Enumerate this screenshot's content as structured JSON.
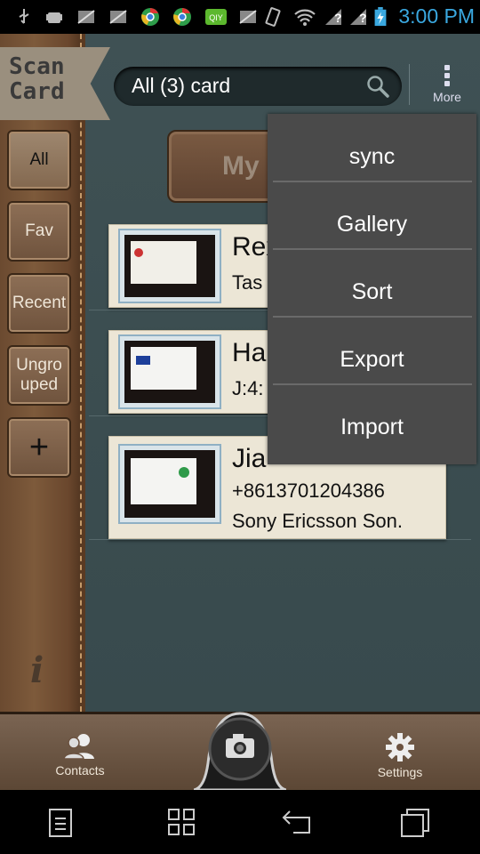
{
  "status_bar": {
    "time": "3:00 PM",
    "icons": [
      "usb-icon",
      "android-icon",
      "muted-notification-icon",
      "muted-notification-icon",
      "chrome-icon",
      "chrome-icon",
      "iqiyi-icon",
      "muted-notification-icon",
      "muted-notification-icon",
      "vibrate-icon",
      "wifi-icon",
      "signal-unknown-icon",
      "signal-unknown-icon",
      "battery-charging-icon"
    ]
  },
  "logo": {
    "line1": "Scan",
    "line2": "Card"
  },
  "search": {
    "text": "All (3) card"
  },
  "more": {
    "label": "More"
  },
  "tabs": [
    {
      "label": "All"
    },
    {
      "label": "Fav"
    },
    {
      "label": "Recent"
    },
    {
      "label": "Ungro\nuped"
    },
    {
      "label": "+"
    }
  ],
  "mycard": {
    "label": "My"
  },
  "cards": [
    {
      "name": "Rex",
      "line2": "Tas",
      "line3": ""
    },
    {
      "name": "Ha",
      "line2": "J:4:",
      "line3": ""
    },
    {
      "name": "Jia",
      "line2": "+8613701204386",
      "line3": "Sony Ericsson Son."
    }
  ],
  "menu": {
    "items": [
      {
        "label": "sync"
      },
      {
        "label": "Gallery"
      },
      {
        "label": "Sort"
      },
      {
        "label": "Export"
      },
      {
        "label": "Import"
      }
    ]
  },
  "bottom_bar": {
    "contacts_label": "Contacts",
    "settings_label": "Settings"
  },
  "colors": {
    "clock": "#3aa8e0",
    "leather": "#7d5a3b",
    "panel": "#3f5154",
    "menu_bg": "#4a4a4a"
  }
}
